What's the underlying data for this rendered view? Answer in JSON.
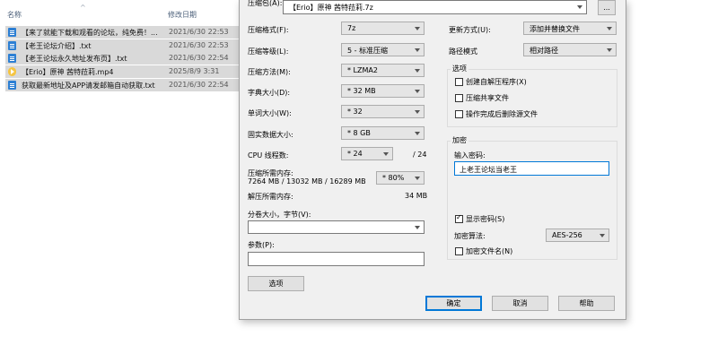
{
  "explorer": {
    "col_name": "名称",
    "col_modified": "修改日期",
    "files": [
      {
        "icon": "txt-file-icon",
        "name": "【来了就能下载和观看的论坛，纯免费！...",
        "date": "2021/6/30 22:53"
      },
      {
        "icon": "txt-file-icon",
        "name": "【老王论坛介绍】.txt",
        "date": "2021/6/30 22:53"
      },
      {
        "icon": "txt-file-icon",
        "name": "【老王论坛永久地址发布页】.txt",
        "date": "2021/6/30 22:54"
      },
      {
        "icon": "video-file-icon",
        "name": "【Erio】原神 茜特菈莉.mp4",
        "date": "2025/8/9 3:31"
      },
      {
        "icon": "txt-file-icon",
        "name": "获取最新地址及APP请发邮箱自动获取.txt",
        "date": "2021/6/30 22:54"
      }
    ]
  },
  "dialog": {
    "archive_label": "压缩包(A):",
    "archive_path": "【Erio】原神 茜特菈莉.7z",
    "browse_label": "...",
    "format_label": "压缩格式(F):",
    "format_value": "7z",
    "level_label": "压缩等级(L):",
    "level_value": "5 - 标准压缩",
    "method_label": "压缩方法(M):",
    "method_value": "* LZMA2",
    "dict_label": "字典大小(D):",
    "dict_value": "* 32 MB",
    "word_label": "单词大小(W):",
    "word_value": "* 32",
    "solid_label": "固实数据大小:",
    "solid_value": "* 8 GB",
    "threads_label": "CPU 线程数:",
    "threads_value": "* 24",
    "threads_total": "/ 24",
    "mem_compress_label": "压缩所需内存:",
    "mem_compress_value": "7264 MB / 13032 MB / 16289 MB",
    "mem_percent": "* 80%",
    "mem_decompress_label": "解压所需内存:",
    "mem_decompress_value": "34 MB",
    "split_label": "分卷大小，字节(V):",
    "split_value": "",
    "params_label": "参数(P):",
    "params_value": "",
    "options_button": "选项",
    "update_label": "更新方式(U):",
    "update_value": "添加并替换文件",
    "path_label": "路径模式",
    "path_value": "相对路径",
    "options_group": "选项",
    "opt_sfx": "创建自解压程序(X)",
    "opt_shared": "压缩共享文件",
    "opt_delete": "操作完成后删除源文件",
    "encrypt_group": "加密",
    "password_label": "输入密码:",
    "password_value": "上老王论坛当老王",
    "show_password": "显示密码(S)",
    "encrypt_method_label": "加密算法:",
    "encrypt_method_value": "AES-256",
    "encrypt_names": "加密文件名(N)",
    "ok_button": "确定",
    "cancel_button": "取消",
    "help_button": "帮助"
  }
}
